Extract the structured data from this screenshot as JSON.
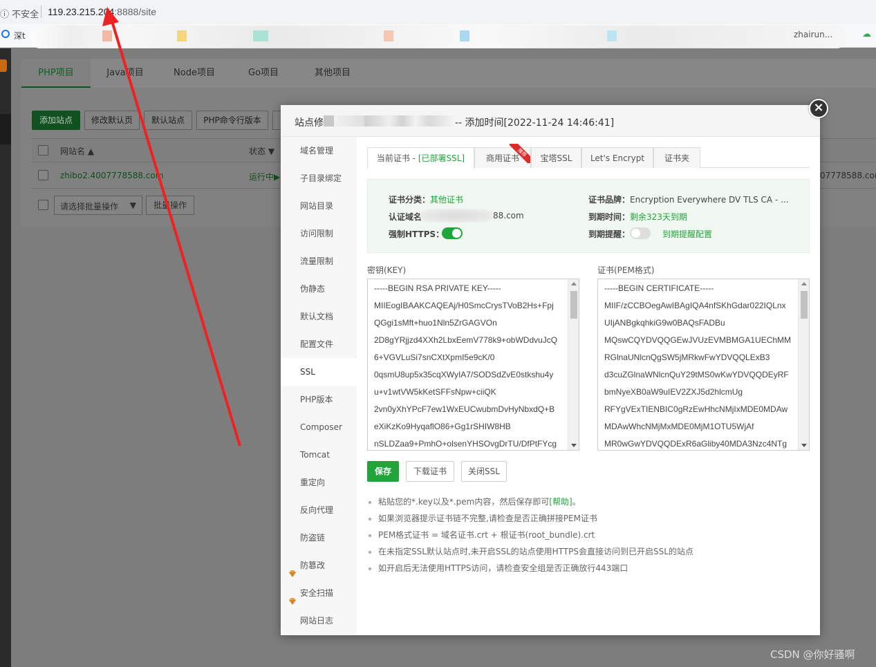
{
  "browser": {
    "insecure_label": "不安全",
    "url_host": "119.23.215.204",
    "url_rest": ":8888/site",
    "bookmark_first": "深t",
    "bookmark_user": "zhairun..."
  },
  "project_tabs": [
    "PHP项目",
    "Java项目",
    "Node项目",
    "Go项目",
    "其他项目"
  ],
  "toolbar": {
    "add_site": "添加站点",
    "edit_default": "修改默认页",
    "default_site": "默认站点",
    "php_cli": "PHP命令行版本"
  },
  "site_table": {
    "col_name": "网站名",
    "col_status": "状态",
    "row_name": "zhibo2.4007778588.com",
    "row_status": "运行中",
    "row_right": "07778588.com",
    "batch_select": "请选择批量操作",
    "batch_btn": "批量操作"
  },
  "modal": {
    "title_prefix": "站点修",
    "title_suffix": "-- 添加时间[2022-11-24 14:46:41]",
    "close": "×",
    "side_items": [
      "域名管理",
      "子目录绑定",
      "网站目录",
      "访问限制",
      "流量限制",
      "伪静态",
      "默认文档",
      "配置文件",
      "SSL",
      "PHP版本",
      "Composer",
      "Tomcat",
      "重定向",
      "反向代理",
      "防盗链",
      "防篡改",
      "安全扫描",
      "网站日志"
    ],
    "active_side": "SSL",
    "ssl_tabs": {
      "current_prefix": "当前证书 - ",
      "current_status": "[已部署SSL]",
      "commercial": "商用证书",
      "recommend_badge": "推荐",
      "bt_ssl": "宝塔SSL",
      "lets_encrypt": "Let's Encrypt",
      "cert_folder": "证书夹"
    },
    "info": {
      "type_label": "证书分类：",
      "type_value": "其他证书",
      "domain_label": "认证域名",
      "domain_value": "88.com",
      "https_label": "强制HTTPS：",
      "brand_label": "证书品牌：",
      "brand_value": "Encryption Everywhere DV TLS CA - ...",
      "expire_label": "到期时间：",
      "expire_value": "剩余323天到期",
      "remind_label": "到期提醒：",
      "remind_link": "到期提醒配置"
    },
    "key_label": "密钥(KEY)",
    "cert_label": "证书(PEM格式)",
    "key_lines": [
      "-----BEGIN RSA PRIVATE KEY-----",
      "MIIEogIBAAKCAQEAj/H0SmcCrysTVoB2Hs+Fpj",
      "QGgi1sMft+huo1Nln5ZrGAGVOn",
      "2D8gYRjjzd4XXh2LbxEemV778k9+obWDdvuJcQ",
      "6+VGVLuSi7snCXtXpmI5e9cK/0",
      "0qsmU8up5x35cqXWyIA7/SODSdZvE0stkshu4y",
      "u+v1wtVW5kKetSFFsNpw+ciiQK",
      "2vn0yXhYPcF7ew1WxEUCwubmDvHyNbxdQ+B",
      "eXiKzKo9HyqaflO86+Gg1rSHIW8HB",
      "nSLDZaa9+PmhO+olsenYHSOvgDrTU/DfPtFYcg"
    ],
    "cert_lines": [
      "-----BEGIN CERTIFICATE-----",
      "MIIF/zCCBOegAwIBAgIQA4nfSKhGdar022IQLnx",
      "UIjANBgkqhkiG9w0BAQsFADBu",
      "MQswCQYDVQQGEwJVUzEVMBMGA1UEChMM",
      "RGlnaUNlcnQgSW5jMRkwFwYDVQQLExB3",
      "d3cuZGlnaWNlcnQuY29tMS0wKwYDVQQDEyRF",
      "bmNyeXB0aW9uIEV2ZXJ5d2hlcmUg",
      "RFYgVExTIENBIC0gRzEwHhcNMjIxMDE0MDAw",
      "MDAwWhcNMjMxMDE0MjM1OTU5WjAf",
      "MR0wGwYDVQQDExR6aGliby40MDA3Nzc4NTg"
    ],
    "buttons": {
      "save": "保存",
      "download": "下载证书",
      "close_ssl": "关闭SSL"
    },
    "tips": {
      "t1_main": "粘贴您的*.key以及*.pem内容，然后保存即可",
      "t1_help": "[帮助]",
      "t1_end": "。",
      "t2": "如果浏览器提示证书链不完整,请检查是否正确拼接PEM证书",
      "t3": "PEM格式证书 = 域名证书.crt + 根证书(root_bundle).crt",
      "t4": "在未指定SSL默认站点时,未开启SSL的站点使用HTTPS会直接访问到已开启SSL的站点",
      "t5": "如开启后无法使用HTTPS访问，请检查安全组是否正确放行443端口"
    }
  },
  "watermark": "CSDN @你好骚啊",
  "colors": {
    "accent": "#20a53a",
    "arrow": "#ee2222"
  }
}
